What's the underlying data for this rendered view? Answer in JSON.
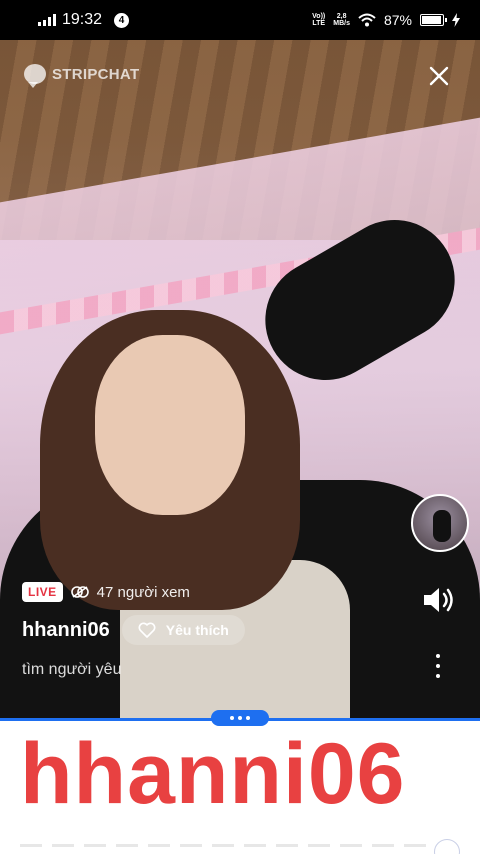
{
  "status_bar": {
    "time": "19:32",
    "notification_count": "4",
    "network_top": "Vo))",
    "network_bottom": "LTE",
    "speed_value": "2,8",
    "speed_unit": "MB/s",
    "battery_percent": "87%",
    "battery_level": 0.87
  },
  "stream": {
    "brand_name": "STRIPCHAT",
    "live_label": "LIVE",
    "viewers_text": "47 người xem",
    "username": "hhanni06",
    "favorite_label": "Yêu thích",
    "subtitle": "tìm người yêu"
  },
  "panel": {
    "big_username": "hhanni06"
  },
  "colors": {
    "live_red": "#e53342",
    "accent_blue": "#1e6ff0",
    "name_red": "#e84141"
  },
  "icons": [
    "close-icon",
    "heart-icon",
    "volume-icon",
    "more-vertical-icon",
    "viewers-icon",
    "brand-logo-icon"
  ]
}
